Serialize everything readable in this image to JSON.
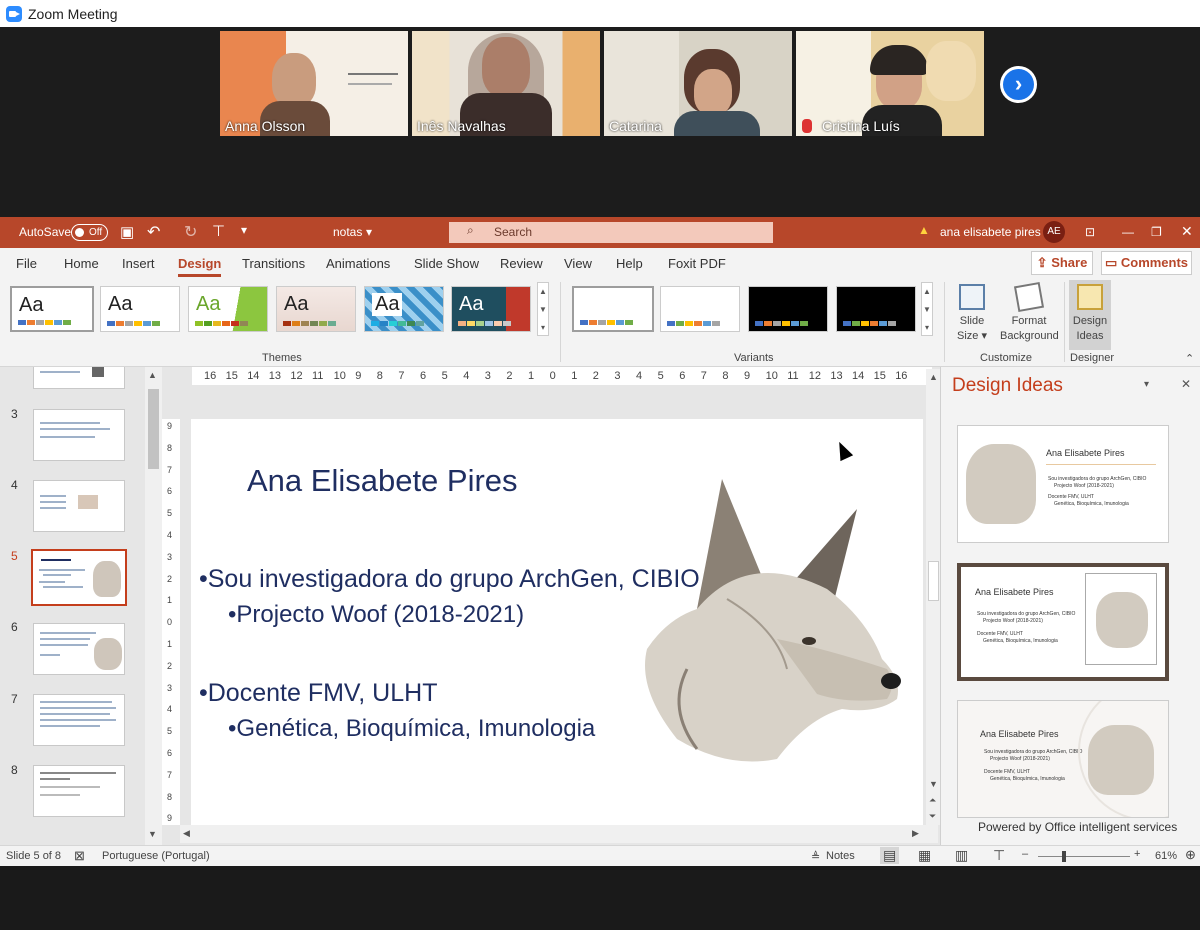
{
  "zoom": {
    "title": "Zoom Meeting",
    "participants": [
      {
        "name": "Anna Olsson"
      },
      {
        "name": "Inês Navalhas"
      },
      {
        "name": "Catarina"
      },
      {
        "name": "Cristina Luís"
      }
    ],
    "next_icon": "chevron-right-icon"
  },
  "titlebar": {
    "autosave_label": "AutoSave",
    "autosave_state": "Off",
    "doc_name": "notas",
    "search_placeholder": "Search",
    "user_name": "ana elisabete pires",
    "user_initials": "AE"
  },
  "menu": {
    "tabs": [
      "File",
      "Home",
      "Insert",
      "Design",
      "Transitions",
      "Animations",
      "Slide Show",
      "Review",
      "View",
      "Help",
      "Foxit PDF"
    ],
    "active": "Design",
    "share": "Share",
    "comments": "Comments"
  },
  "ribbon": {
    "themes_label": "Themes",
    "variants_label": "Variants",
    "customize_label": "Customize",
    "designer_label": "Designer",
    "theme_aa": "Aa",
    "slide_size": "Slide Size",
    "format_background_1": "Format",
    "format_background_2": "Background",
    "design_ideas_1": "Design",
    "design_ideas_2": "Ideas",
    "slide_size_1": "Slide",
    "slide_size_2": "Size"
  },
  "thumbnails": [
    {
      "num": "3"
    },
    {
      "num": "4"
    },
    {
      "num": "5"
    },
    {
      "num": "6"
    },
    {
      "num": "7"
    },
    {
      "num": "8"
    }
  ],
  "ruler": {
    "h": [
      "16",
      "15",
      "14",
      "13",
      "12",
      "11",
      "10",
      "9",
      "8",
      "7",
      "6",
      "5",
      "4",
      "3",
      "2",
      "1",
      "0",
      "1",
      "2",
      "3",
      "4",
      "5",
      "6",
      "7",
      "8",
      "9",
      "10",
      "11",
      "12",
      "13",
      "14",
      "15",
      "16"
    ],
    "v": [
      "9",
      "8",
      "7",
      "6",
      "5",
      "4",
      "3",
      "2",
      "1",
      "0",
      "1",
      "2",
      "3",
      "4",
      "5",
      "6",
      "7",
      "8",
      "9"
    ]
  },
  "slide": {
    "title": "Ana Elisabete Pires",
    "bullet1": "•Sou investigadora do grupo ArchGen, CIBIO",
    "sub1": "•Projecto Woof (2018-2021)",
    "bullet2": "•Docente FMV, ULHT",
    "sub2": "•Genética, Bioquímica, Imunologia"
  },
  "design_pane": {
    "title": "Design Ideas",
    "card_title": "Ana Elisabete Pires",
    "card_b1": "Sou investigadora do grupo ArchGen, CIBIO",
    "card_b1s": "Projecto Woof (2018-2021)",
    "card_b2": "Docente FMV, ULHT",
    "card_b2s": "Genética, Bioquímica, Imunologia",
    "powered": "Powered by Office intelligent services"
  },
  "status": {
    "slide_info": "Slide 5 of 8",
    "language": "Portuguese (Portugal)",
    "notes": "Notes",
    "zoom": "61%"
  },
  "colors": {
    "accent": "#b7472a",
    "slide_text": "#1f2e61",
    "design_title": "#c43e1c"
  }
}
